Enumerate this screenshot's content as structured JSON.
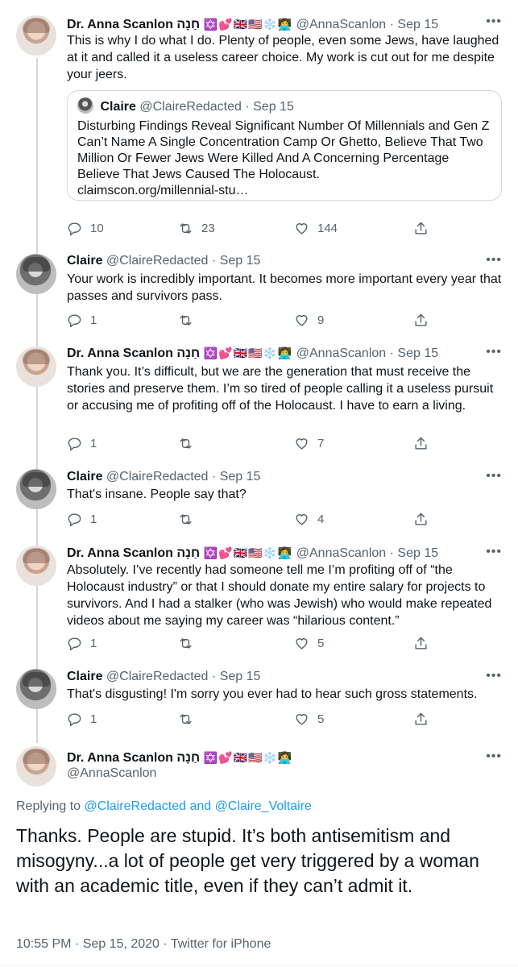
{
  "colors": {
    "accent": "#1d9bf0",
    "muted": "#536471",
    "thread_line": "#cfd9de"
  },
  "tweets": [
    {
      "name": "Dr. Anna Scanlon חַנָה",
      "emoji": "✡️💕🇬🇧🇺🇸❄️👩‍💻",
      "handle": "@AnnaScanlon",
      "date": "Sep 15",
      "text": "This is why I do what I do. Plenty of people, even some Jews, have laughed at it and called it a useless career choice. My work is cut out for me despite your jeers.",
      "quote": {
        "name": "Claire",
        "handle": "@ClaireRedacted",
        "date": "Sep 15",
        "text": "Disturbing Findings Reveal Significant Number Of Millennials and Gen Z Can’t Name A Single Concentration Camp Or Ghetto, Believe That Two Million Or Fewer Jews Were Killed And A Concerning Percentage Believe That Jews Caused The Holocaust.",
        "link": "claimscon.org/millennial-stu…"
      },
      "replies": "10",
      "retweets": "23",
      "likes": "144"
    },
    {
      "name": "Claire",
      "handle": "@ClaireRedacted",
      "date": "Sep 15",
      "text": "Your work is incredibly important. It becomes more important every year that passes and survivors pass.",
      "replies": "1",
      "retweets": "",
      "likes": "9"
    },
    {
      "name": "Dr. Anna Scanlon חַנָה",
      "emoji": "✡️💕🇬🇧🇺🇸❄️👩‍💻",
      "handle": "@AnnaScanlon",
      "date": "Sep 15",
      "text": "Thank you. It’s difficult, but we are the generation that must receive the stories and preserve them. I’m so tired of people calling it a useless pursuit or accusing me of profiting off of the Holocaust. I have to earn a living.",
      "replies": "1",
      "retweets": "",
      "likes": "7"
    },
    {
      "name": "Claire",
      "handle": "@ClaireRedacted",
      "date": "Sep 15",
      "text": "That's insane. People say that?",
      "replies": "1",
      "retweets": "",
      "likes": "4"
    },
    {
      "name": "Dr. Anna Scanlon חַנָה",
      "emoji": "✡️💕🇬🇧🇺🇸❄️👩‍💻",
      "handle": "@AnnaScanlon",
      "date": "Sep 15",
      "text": "Absolutely. I’ve recently had someone tell me I’m profiting off of “the Holocaust industry” or that I should donate my entire salary for projects to survivors. And I had a stalker (who was Jewish) who would make repeated videos about me saying my career was “hilarious content.”",
      "replies": "1",
      "retweets": "",
      "likes": "5"
    },
    {
      "name": "Claire",
      "handle": "@ClaireRedacted",
      "date": "Sep 15",
      "text": "That's disgusting! I'm sorry you ever had to hear such gross statements.",
      "replies": "1",
      "retweets": "",
      "likes": "5"
    }
  ],
  "main": {
    "name": "Dr. Anna Scanlon חַנָה",
    "emoji": "✡️💕🇬🇧🇺🇸❄️👩‍💻",
    "handle": "@AnnaScanlon",
    "replying_prefix": "Replying to",
    "mention_1": "@ClaireRedacted",
    "and_word": "and",
    "mention_2": "@Claire_Voltaire",
    "text": "Thanks. People are stupid. It’s both antisemitism and misogyny...a lot of people get very triggered by a woman with an academic title, even if they can’t admit it.",
    "time": "10:55 PM",
    "date": "Sep 15, 2020",
    "client": "Twitter for iPhone"
  },
  "icons": {
    "reply": "reply-icon",
    "retweet": "retweet-icon",
    "like": "heart-icon",
    "share": "share-icon",
    "more": "more-icon"
  }
}
